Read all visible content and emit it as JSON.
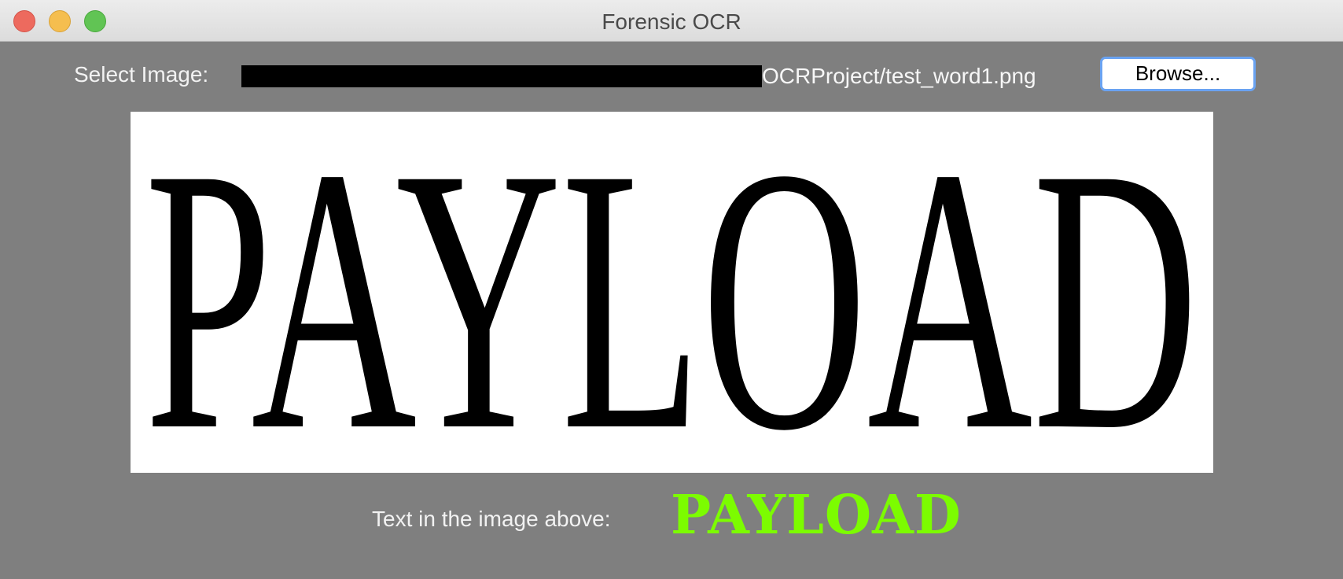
{
  "window": {
    "title": "Forensic OCR"
  },
  "form": {
    "select_label": "Select Image:",
    "path_visible": "OCRProject/test_word1.png",
    "browse_label": "Browse..."
  },
  "preview": {
    "word": "PAYLOAD"
  },
  "result": {
    "label": "Text in the image above:",
    "value": "PAYLOAD",
    "color": "#7cfc00"
  }
}
